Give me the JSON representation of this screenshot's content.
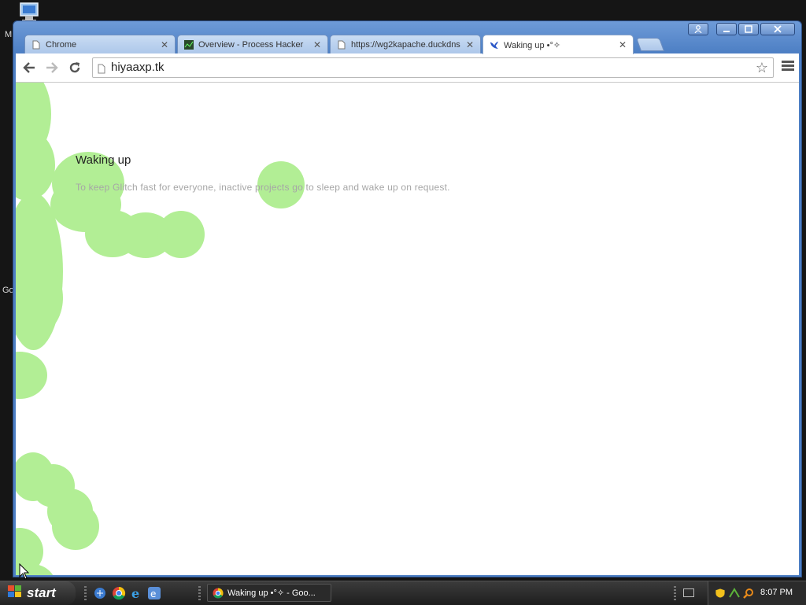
{
  "desktop": {
    "icon": "my-computer-icon",
    "label_top": "M",
    "label_mid": "Go"
  },
  "window": {
    "controls": [
      "profile-icon",
      "minimize-icon",
      "maximize-icon",
      "close-icon"
    ],
    "tabs": [
      {
        "label": "Chrome",
        "icon": "page-icon",
        "active": false
      },
      {
        "label": "Overview - Process Hacker",
        "icon": "process-hacker-icon",
        "active": false
      },
      {
        "label": "https://wg2kapache.duckdns",
        "icon": "page-icon",
        "active": false
      },
      {
        "label": "Waking up •°✧",
        "icon": "bird-icon",
        "active": true
      }
    ],
    "address": "hiyaaxp.tk"
  },
  "page": {
    "title": "Waking up",
    "subtitle": "To keep Glitch fast for everyone, inactive projects go to sleep and wake up on request.",
    "blob_color": "#b2ee95"
  },
  "taskbar": {
    "start_label": "start",
    "task_label": "Waking up •°✧ - Goo...",
    "clock": "8:07 PM"
  }
}
